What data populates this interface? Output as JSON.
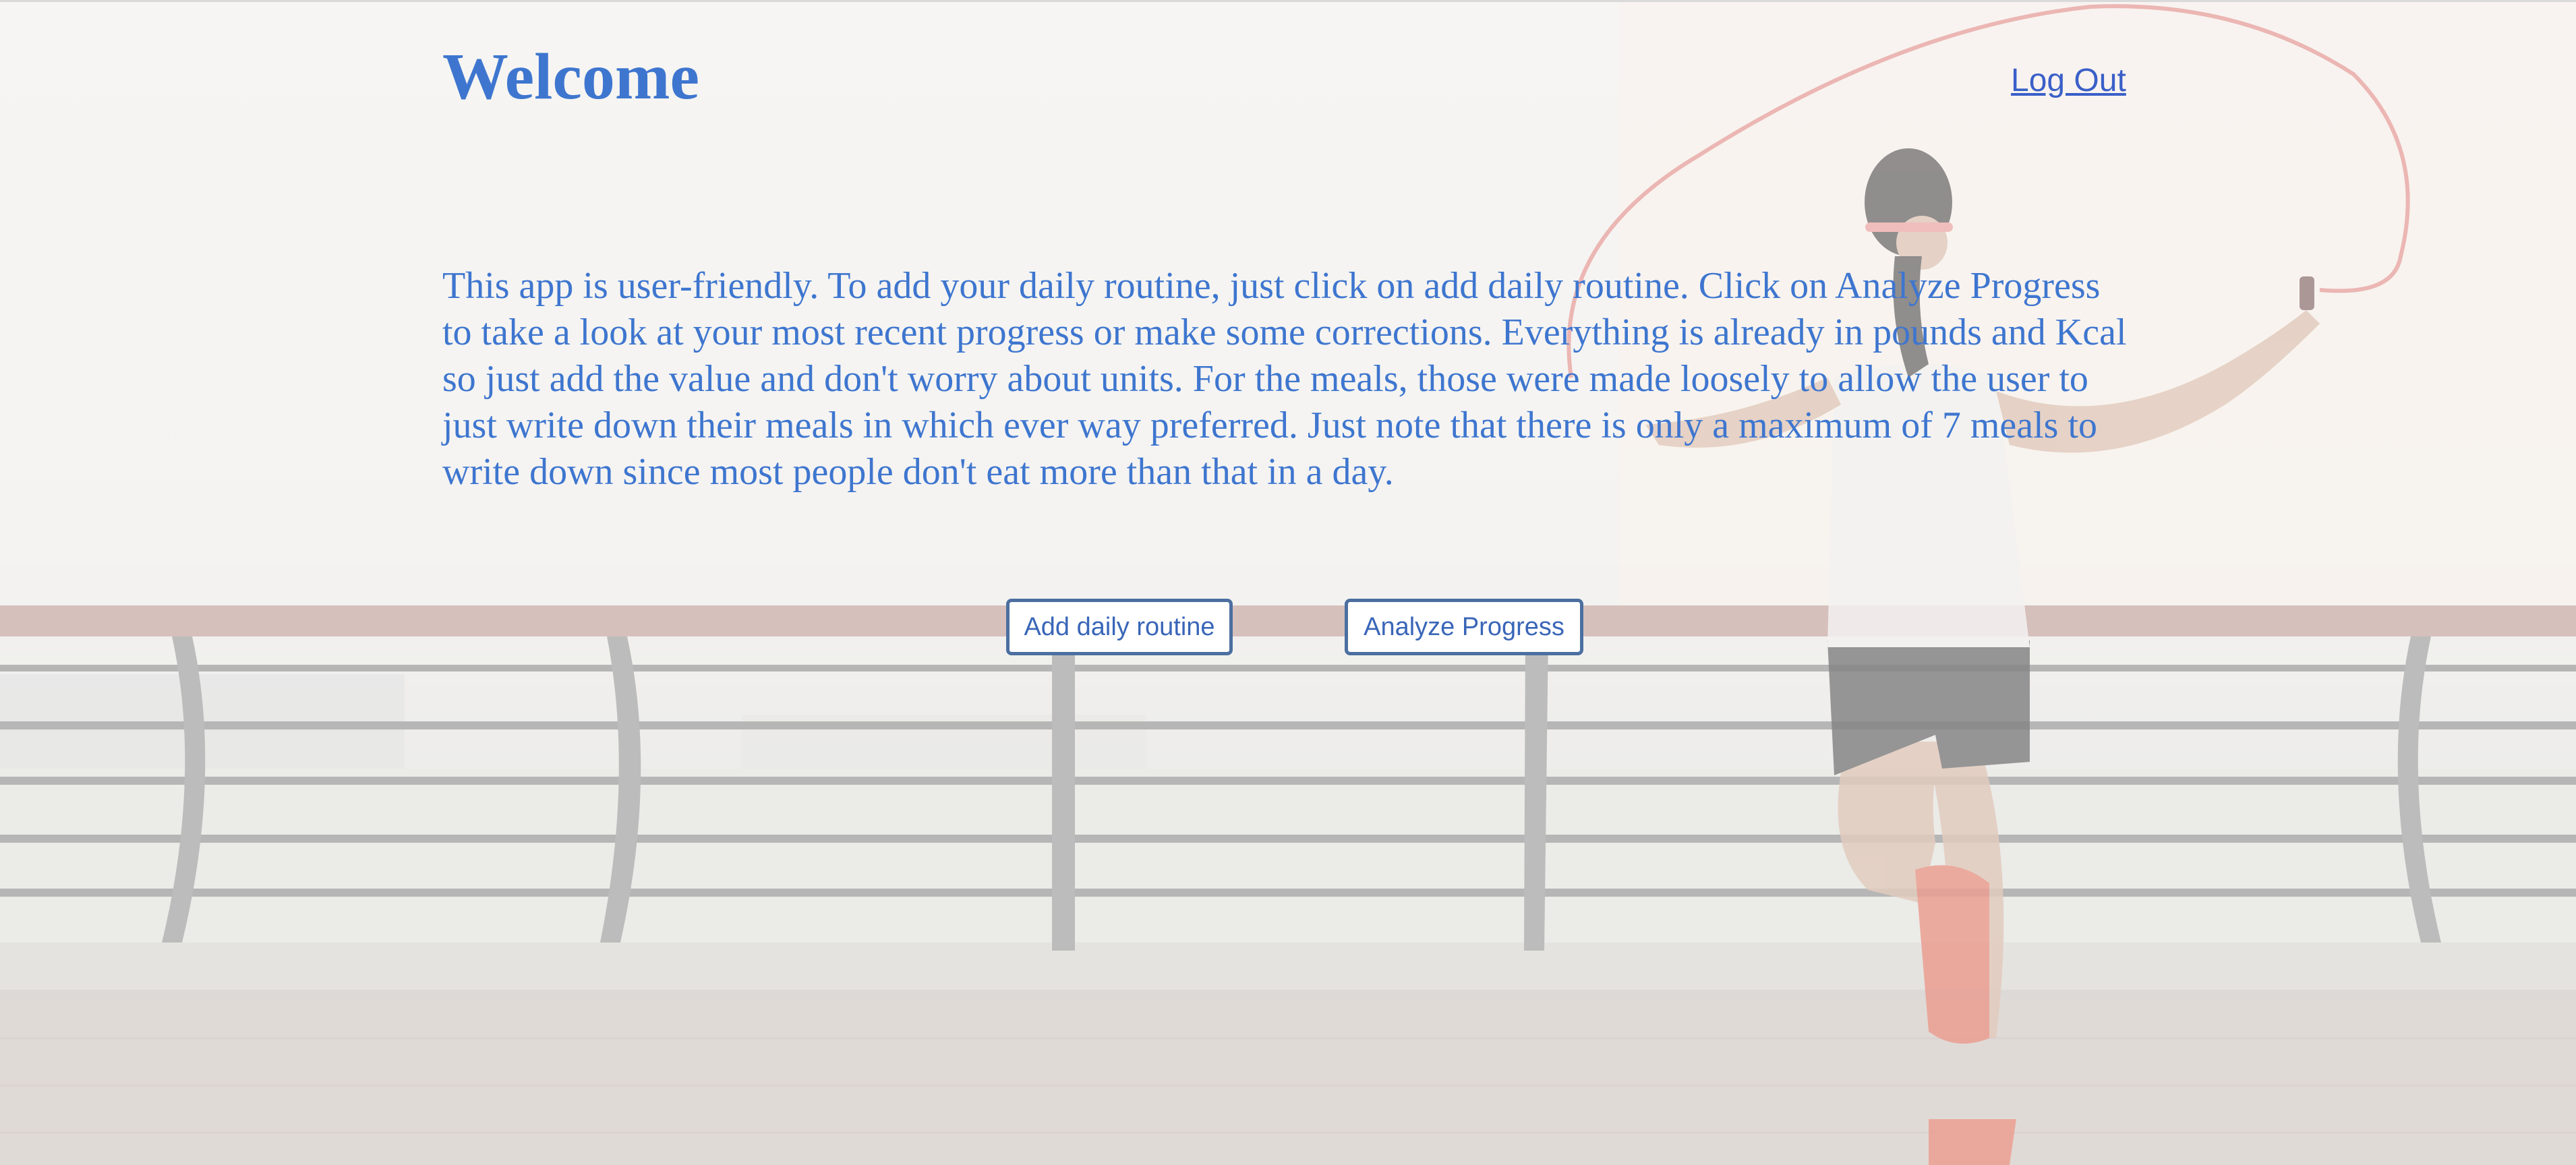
{
  "header": {
    "title": "Welcome",
    "logout_label": "Log Out"
  },
  "intro": {
    "text": "This app is user-friendly. To add your daily routine, just click on add daily routine. Click on Analyze Progress to take a look at your most recent progress or make some corrections. Everything is already in pounds and Kcal so just add the value and don't worry about units. For the meals, those were made loosely to allow the user to just write down their meals in which ever way preferred. Just note that there is only a maximum of 7 meals to write down since most people don't eat more than that in a day."
  },
  "actions": {
    "add_label": "Add daily routine",
    "analyze_label": "Analyze Progress"
  },
  "colors": {
    "text_blue": "#3e76cf",
    "button_border": "#4b6fa0"
  }
}
